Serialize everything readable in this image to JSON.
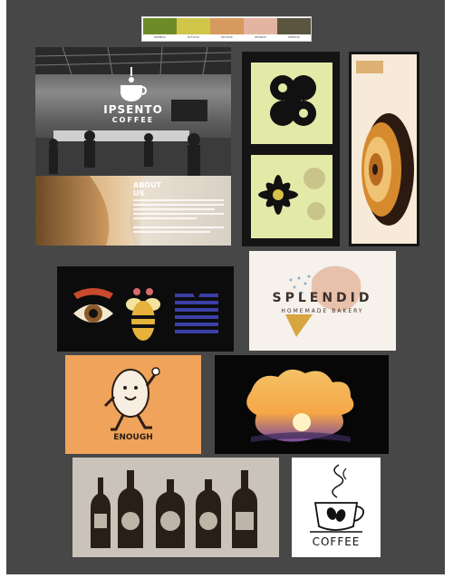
{
  "palette": {
    "swatches": [
      {
        "color": "#6e8b2a",
        "hex": "#6E8B2A"
      },
      {
        "color": "#cfc64a",
        "hex": "#CFC64A"
      },
      {
        "color": "#d79a5e",
        "hex": "#D79A5E"
      },
      {
        "color": "#e3b4a0",
        "hex": "#E3B4A0"
      },
      {
        "color": "#5b5540",
        "hex": "#5B5540"
      }
    ]
  },
  "ipsento": {
    "brand_line1": "IPSENTO",
    "brand_line2": "COFFEE",
    "about_heading": "ABOUT US"
  },
  "splendid": {
    "title": "SPLENDID",
    "subtitle": "HOMEMADE BAKERY"
  },
  "enough": {
    "wordmark": "ENOUGH"
  },
  "coffee_logo": {
    "wordmark": "COFFEE"
  },
  "colors": {
    "board": "#474747",
    "lime": "#dfe7a0",
    "orange": "#f0a35a",
    "cream": "#f6efe4"
  }
}
